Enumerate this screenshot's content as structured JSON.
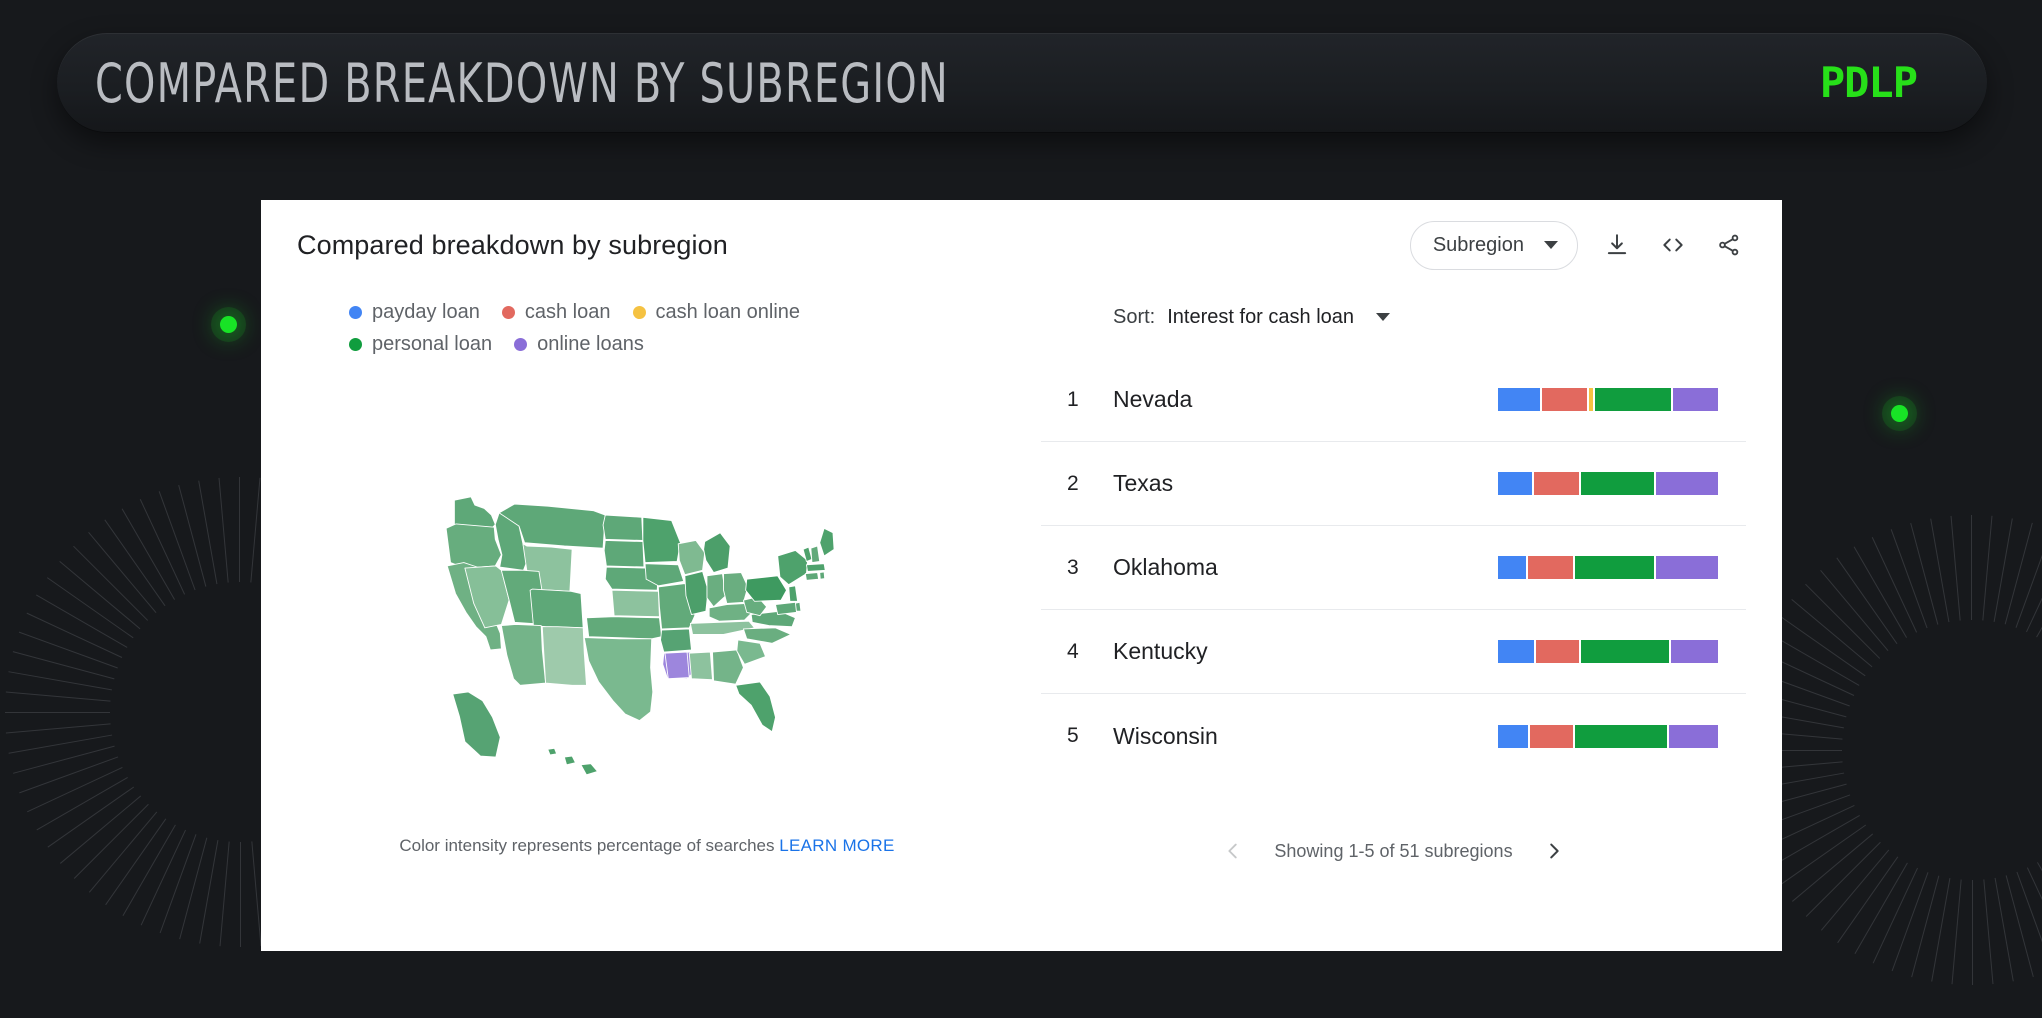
{
  "banner": {
    "title": "COMPARED BREAKDOWN BY SUBREGION",
    "logo": "PDLP",
    "logo_color": "#27e019"
  },
  "card": {
    "title": "Compared breakdown by subregion",
    "region_selector": {
      "label": "Subregion",
      "icon": "chevron-down-icon"
    },
    "actions": [
      {
        "name": "download-icon",
        "tooltip": "Download"
      },
      {
        "name": "embed-code-icon",
        "tooltip": "Embed"
      },
      {
        "name": "share-icon",
        "tooltip": "Share"
      }
    ]
  },
  "legend": [
    {
      "label": "payday loan",
      "color": "#4285f4"
    },
    {
      "label": "cash loan",
      "color": "#e2695f"
    },
    {
      "label": "cash loan online",
      "color": "#f5c242"
    },
    {
      "label": "personal loan",
      "color": "#109d3e"
    },
    {
      "label": "online loans",
      "color": "#8a6ed8"
    }
  ],
  "map": {
    "note_text": "Color intensity represents percentage of searches",
    "note_link": "LEARN MORE",
    "link_color": "#1a73e8",
    "base_color": "#62ab79",
    "highlight_color": "#9d86dd",
    "border_color": "#ffffff",
    "highlighted_states": [
      "Louisiana",
      "Mississippi"
    ]
  },
  "sort": {
    "label": "Sort:",
    "value": "Interest for cash loan",
    "icon": "chevron-down-icon"
  },
  "pagination": {
    "text": "Showing 1-5 of 51 subregions",
    "prev_icon": "chevron-left-icon",
    "next_icon": "chevron-right-icon",
    "prev_enabled": false,
    "next_enabled": true
  },
  "chart_data": {
    "type": "bar",
    "title": "Compared breakdown by subregion",
    "subtitle": "Interest for cash loan",
    "stacked": true,
    "normalized": true,
    "categories": [
      "Nevada",
      "Texas",
      "Oklahoma",
      "Kentucky",
      "Wisconsin"
    ],
    "ranks": [
      1,
      2,
      3,
      4,
      5
    ],
    "series": [
      {
        "name": "payday loan",
        "color": "#4285f4",
        "values": [
          20,
          16,
          13,
          17,
          14
        ]
      },
      {
        "name": "cash loan",
        "color": "#e2695f",
        "values": [
          21,
          21,
          21,
          20,
          20
        ]
      },
      {
        "name": "cash loan online",
        "color": "#f5c242",
        "values": [
          2,
          0,
          0,
          0,
          0
        ]
      },
      {
        "name": "personal loan",
        "color": "#109d3e",
        "values": [
          36,
          34,
          37,
          41,
          43
        ]
      },
      {
        "name": "online loans",
        "color": "#8a6ed8",
        "values": [
          21,
          29,
          29,
          22,
          23
        ]
      }
    ],
    "xlabel": "",
    "ylabel": "",
    "legend_position": "top-left",
    "grid": false
  }
}
